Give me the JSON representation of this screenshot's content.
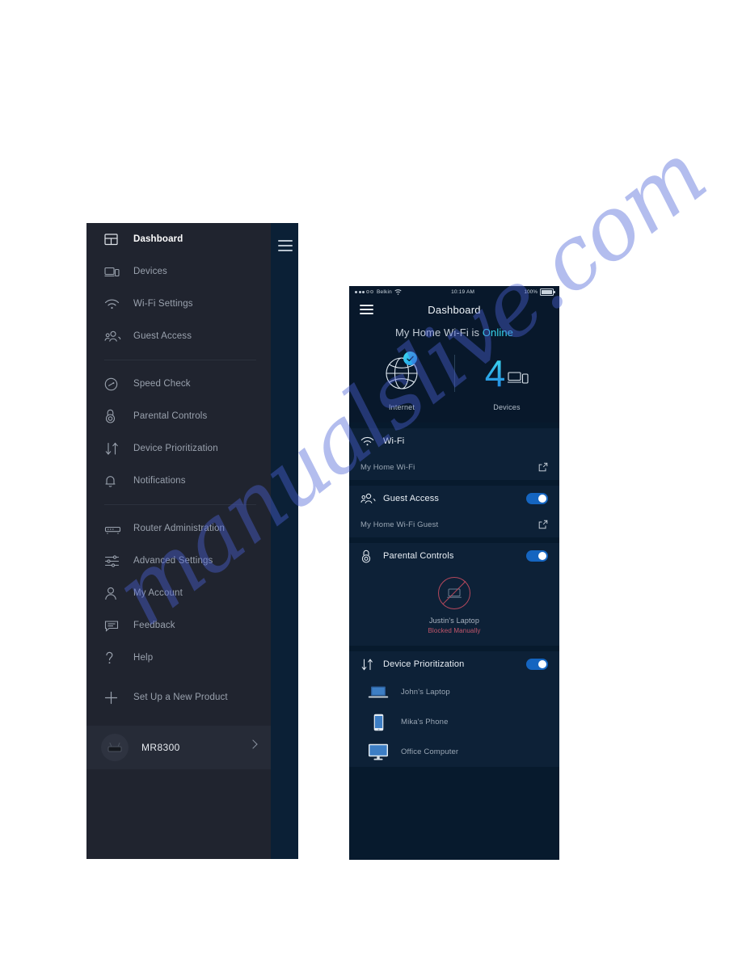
{
  "sidebar": {
    "rail_icon": "hamburger-icon",
    "items": [
      {
        "label": "Dashboard",
        "icon": "dashboard-icon",
        "active": true
      },
      {
        "label": "Devices",
        "icon": "devices-icon",
        "active": false
      },
      {
        "label": "Wi-Fi Settings",
        "icon": "wifi-icon",
        "active": false
      },
      {
        "label": "Guest Access",
        "icon": "guest-access-icon",
        "active": false
      },
      {
        "label": "Speed Check",
        "icon": "speedometer-icon",
        "active": false
      },
      {
        "label": "Parental Controls",
        "icon": "lock-icon",
        "active": false
      },
      {
        "label": "Device Prioritization",
        "icon": "arrows-updown-icon",
        "active": false
      },
      {
        "label": "Notifications",
        "icon": "bell-icon",
        "active": false
      },
      {
        "label": "Router Administration",
        "icon": "router-icon",
        "active": false
      },
      {
        "label": "Advanced Settings",
        "icon": "sliders-icon",
        "active": false
      },
      {
        "label": "My Account",
        "icon": "person-icon",
        "active": false
      },
      {
        "label": "Feedback",
        "icon": "chat-icon",
        "active": false
      },
      {
        "label": "Help",
        "icon": "question-icon",
        "active": false
      },
      {
        "label": "Set Up a New Product",
        "icon": "plus-icon",
        "active": false
      }
    ],
    "router": {
      "name": "MR8300",
      "avatar_icon": "router-avatar-icon",
      "chevron_icon": "chevron-right-icon"
    }
  },
  "phone": {
    "status_bar": {
      "carrier": "Belkin",
      "signal_icon": "signal-dots-icon",
      "wifi_icon": "wifi-icon",
      "time": "10:19 AM",
      "battery_text": "100%",
      "battery_icon": "battery-full-icon"
    },
    "app_bar": {
      "menu_icon": "hamburger-icon",
      "title": "Dashboard"
    },
    "hero": {
      "status_prefix": "My Home Wi-Fi is ",
      "status_state": "Online",
      "internet": {
        "label": "Internet",
        "icon": "globe-icon",
        "badge_icon": "check-badge-icon"
      },
      "devices": {
        "count": "4",
        "label": "Devices",
        "icon": "devices-icon"
      }
    },
    "cards": {
      "wifi": {
        "title": "Wi-Fi",
        "icon": "wifi-icon",
        "network_name": "My Home Wi-Fi",
        "open_icon": "external-link-icon"
      },
      "guest_access": {
        "title": "Guest Access",
        "icon": "guest-access-icon",
        "toggle_on": true,
        "network_name": "My Home Wi-Fi Guest",
        "open_icon": "external-link-icon"
      },
      "parental_controls": {
        "title": "Parental Controls",
        "icon": "lock-icon",
        "toggle_on": true,
        "blocked_device": "Justin's Laptop",
        "blocked_status": "Blocked Manually",
        "blocked_icon": "blocked-laptop-icon"
      },
      "device_prioritization": {
        "title": "Device Prioritization",
        "icon": "arrows-updown-icon",
        "toggle_on": true,
        "devices": [
          {
            "name": "John's Laptop",
            "icon": "laptop-icon"
          },
          {
            "name": "Mika's Phone",
            "icon": "phone-icon"
          },
          {
            "name": "Office Computer",
            "icon": "desktop-icon"
          }
        ]
      }
    }
  },
  "watermark": {
    "text": "manualslive.com",
    "color": "#4b63d8"
  },
  "colors": {
    "sidebar_bg": "#20242f",
    "sidebar_rail_bg": "#0b2036",
    "phone_bg": "#071a2d",
    "card_bg": "#0d2137",
    "accent_cyan": "#37d6ef",
    "toggle_blue": "#1565c0",
    "blocked_red": "#c4566b"
  }
}
